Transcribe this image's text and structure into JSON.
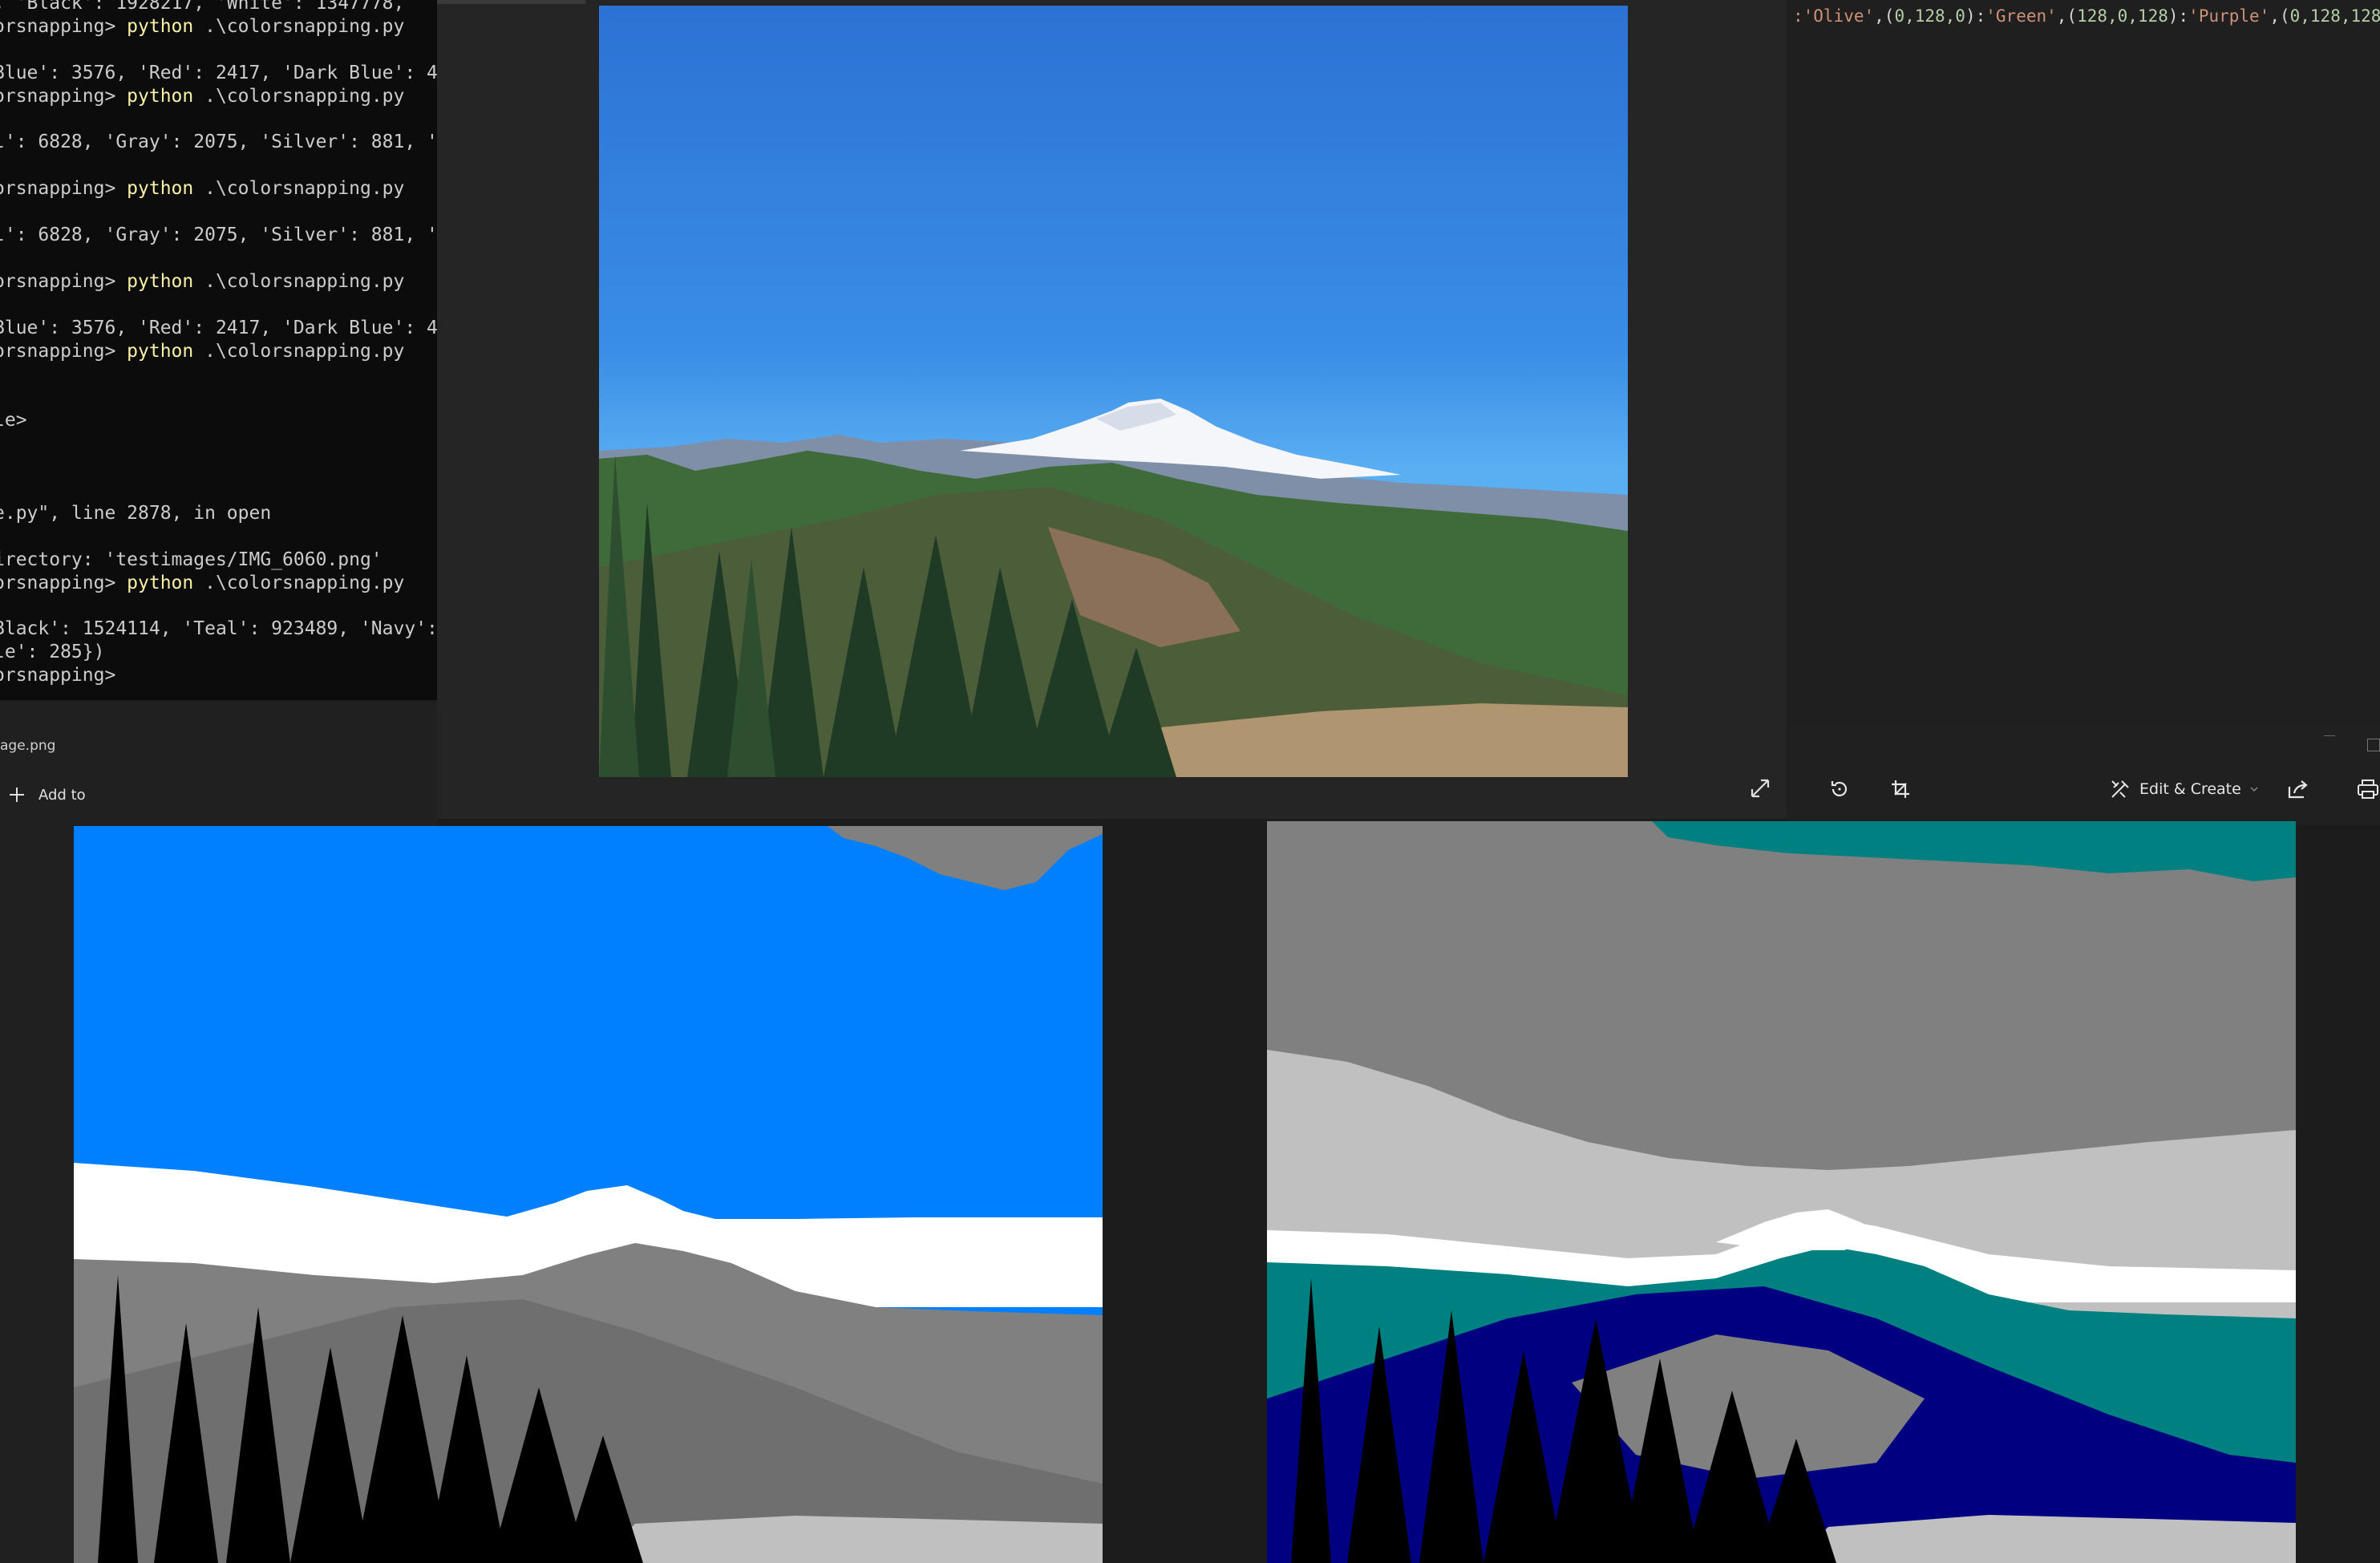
{
  "terminal": {
    "lines": [
      {
        "text": ", 'Black': 1928217, 'White': 1347778, ",
        "kw": "",
        "rest": ""
      },
      {
        "text": "orsnapping> ",
        "kw": "python",
        "rest": " .\\colorsnapping.py"
      },
      {
        "text": "",
        "kw": "",
        "rest": ""
      },
      {
        "text": "Blue': 3576, 'Red': 2417, 'Dark Blue': 4",
        "kw": "",
        "rest": ""
      },
      {
        "text": "orsnapping> ",
        "kw": "python",
        "rest": " .\\colorsnapping.py"
      },
      {
        "text": "",
        "kw": "",
        "rest": ""
      },
      {
        "text": "l': 6828, 'Gray': 2075, 'Silver': 881, '",
        "kw": "",
        "rest": ""
      },
      {
        "text": "",
        "kw": "",
        "rest": ""
      },
      {
        "text": "orsnapping> ",
        "kw": "python",
        "rest": " .\\colorsnapping.py"
      },
      {
        "text": "",
        "kw": "",
        "rest": ""
      },
      {
        "text": "l': 6828, 'Gray': 2075, 'Silver': 881, '",
        "kw": "",
        "rest": ""
      },
      {
        "text": "",
        "kw": "",
        "rest": ""
      },
      {
        "text": "orsnapping> ",
        "kw": "python",
        "rest": " .\\colorsnapping.py"
      },
      {
        "text": "",
        "kw": "",
        "rest": ""
      },
      {
        "text": "Blue': 3576, 'Red': 2417, 'Dark Blue': 4",
        "kw": "",
        "rest": ""
      },
      {
        "text": "orsnapping> ",
        "kw": "python",
        "rest": " .\\colorsnapping.py"
      },
      {
        "text": "",
        "kw": "",
        "rest": ""
      },
      {
        "text": "",
        "kw": "",
        "rest": ""
      },
      {
        "text": "le>",
        "kw": "",
        "rest": ""
      },
      {
        "text": "",
        "kw": "",
        "rest": ""
      },
      {
        "text": "",
        "kw": "",
        "rest": ""
      },
      {
        "text": "",
        "kw": "",
        "rest": ""
      },
      {
        "text": "e.py\", line 2878, in open",
        "kw": "",
        "rest": ""
      },
      {
        "text": "",
        "kw": "",
        "rest": ""
      },
      {
        "text": "irectory: 'testimages/IMG_6060.png'",
        "kw": "",
        "rest": ""
      },
      {
        "text": "orsnapping> ",
        "kw": "python",
        "rest": " .\\colorsnapping.py"
      },
      {
        "text": "",
        "kw": "",
        "rest": ""
      },
      {
        "text": "Black': 1524114, 'Teal': 923489, 'Navy':",
        "kw": "",
        "rest": ""
      },
      {
        "text": "le': 285})",
        "kw": "",
        "rest": ""
      },
      {
        "text": "orsnapping>",
        "kw": "",
        "rest": ""
      }
    ]
  },
  "editor": {
    "code_parts": [
      {
        "t": ":'Olive'",
        "c": "str"
      },
      {
        "t": ",(",
        "c": "punc"
      },
      {
        "t": "0,128,0",
        "c": "num"
      },
      {
        "t": "):",
        "c": "punc"
      },
      {
        "t": "'Green'",
        "c": "str"
      },
      {
        "t": ",(",
        "c": "punc"
      },
      {
        "t": "128,0,128",
        "c": "num"
      },
      {
        "t": "):",
        "c": "punc"
      },
      {
        "t": "'Purple'",
        "c": "str"
      },
      {
        "t": ",(",
        "c": "punc"
      },
      {
        "t": "0,128,128",
        "c": "num"
      },
      {
        "t": "):'",
        "c": "punc"
      }
    ]
  },
  "left_viewer": {
    "file_name": "age.png",
    "add_to_label": "Add to",
    "add_icon": "plus-icon"
  },
  "right_viewer": {
    "edit_create_label": "Edit & Create",
    "icons": [
      "rotate-icon",
      "crop-icon",
      "edit-create-icon",
      "share-icon",
      "print-icon"
    ]
  },
  "popup": {
    "expand_icon": "expand-icon"
  },
  "colors": {
    "sky_blue": "#0080ff",
    "teal": "#008080",
    "navy": "#000080",
    "gray": "#808080",
    "silver": "#c0c0c0"
  }
}
